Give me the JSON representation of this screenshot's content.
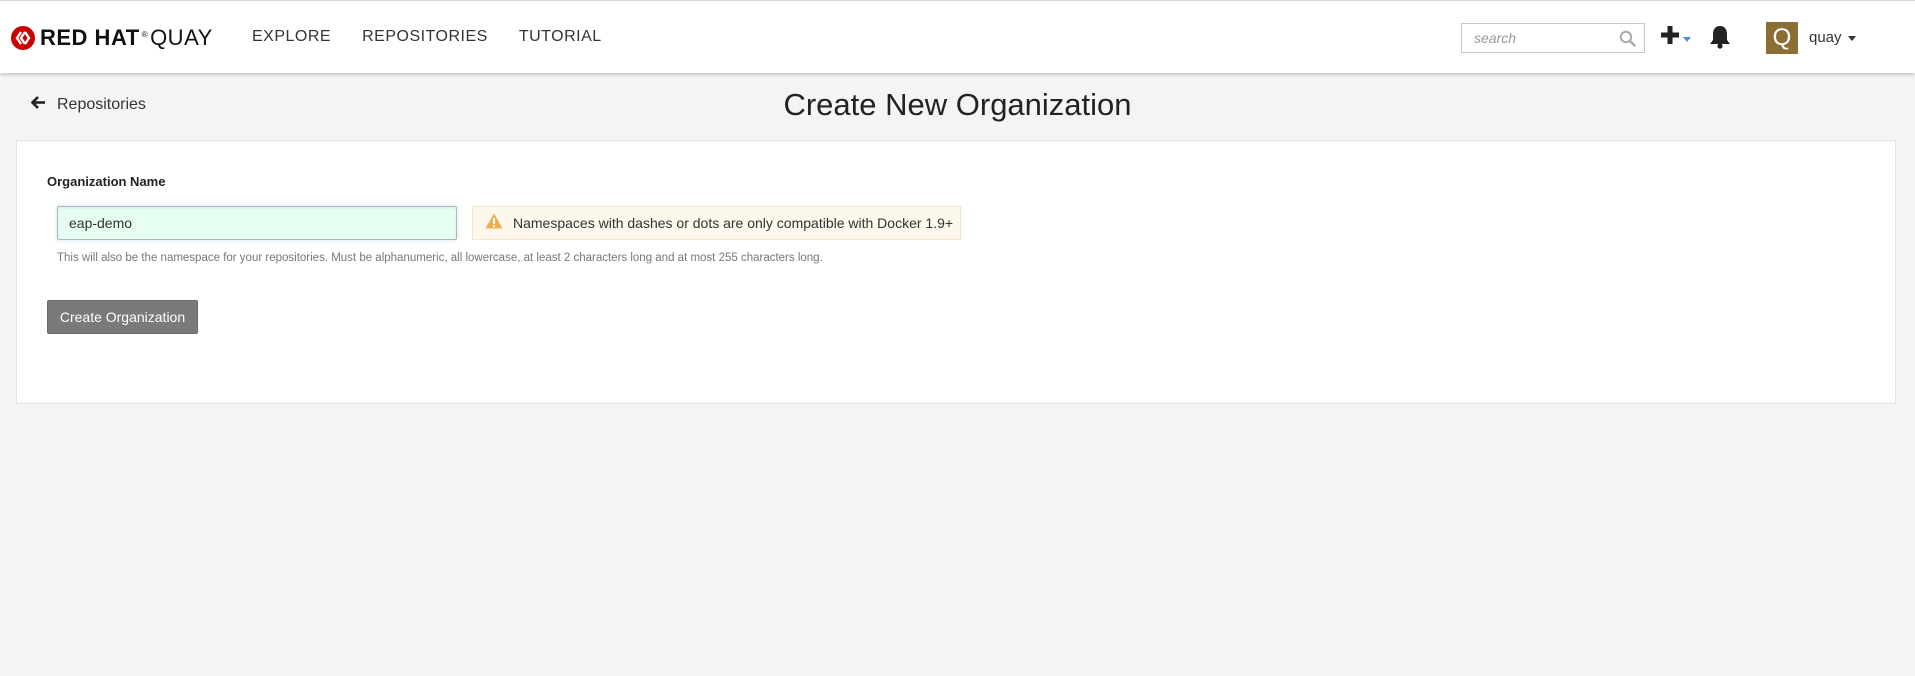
{
  "navbar": {
    "brand_bold": "RED HAT",
    "brand_reg": "®",
    "brand_thin": "QUAY",
    "links": [
      "EXPLORE",
      "REPOSITORIES",
      "TUTORIAL"
    ],
    "search_placeholder": "search",
    "user": {
      "avatar_letter": "Q",
      "name": "quay",
      "avatar_color": "#8b6e33"
    }
  },
  "header": {
    "back_label": "Repositories",
    "title": "Create New Organization"
  },
  "form": {
    "org_name_label": "Organization Name",
    "org_name_value": "eap-demo",
    "warning": "Namespaces with dashes or dots are only compatible with Docker 1.9+",
    "help": "This will also be the namespace for your repositories. Must be alphanumeric, all lowercase, at least 2 characters long and at most 255 characters long.",
    "submit_label": "Create Organization"
  },
  "colors": {
    "brand_red": "#cc0000",
    "warning_orange": "#f0ad4e",
    "input_valid_bg": "#e6fff2",
    "button_gray": "#7a7a7a"
  },
  "icons": [
    "redhat-logo-icon",
    "search-icon",
    "plus-icon",
    "caret-down-icon",
    "bell-icon",
    "arrow-left-icon",
    "warning-icon"
  ]
}
